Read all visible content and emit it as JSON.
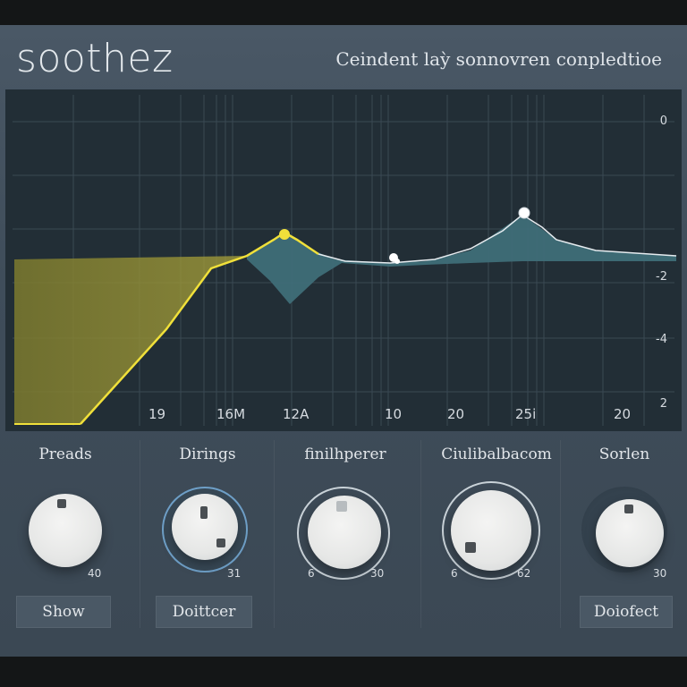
{
  "header": {
    "title": "soothez",
    "subtitle": "Ceindent laỳ sonnovren conpledtioe"
  },
  "eq": {
    "freq_labels": [
      "19",
      "16M",
      "12A",
      "10",
      "20",
      "25i",
      "20"
    ],
    "db_labels": [
      "0",
      "-2",
      "-4",
      "2"
    ],
    "colors": {
      "yellow": "#f0e03a",
      "teal": "#3f6e78",
      "grid": "#3a4953"
    }
  },
  "modules": [
    {
      "title": "Preads",
      "scale_min": "",
      "scale_max": "40",
      "button": "Show"
    },
    {
      "title": "Dirings",
      "scale_min": "",
      "scale_max": "31",
      "button": "Doittcer"
    },
    {
      "title": "finilhperer",
      "scale_min": "6",
      "scale_max": "30",
      "button": ""
    },
    {
      "title": "Ciulibalbacom",
      "scale_min": "6",
      "scale_max": "62",
      "button": ""
    },
    {
      "title": "Sorlen",
      "scale_min": "",
      "scale_max": "30",
      "button": "Doiofect"
    }
  ]
}
